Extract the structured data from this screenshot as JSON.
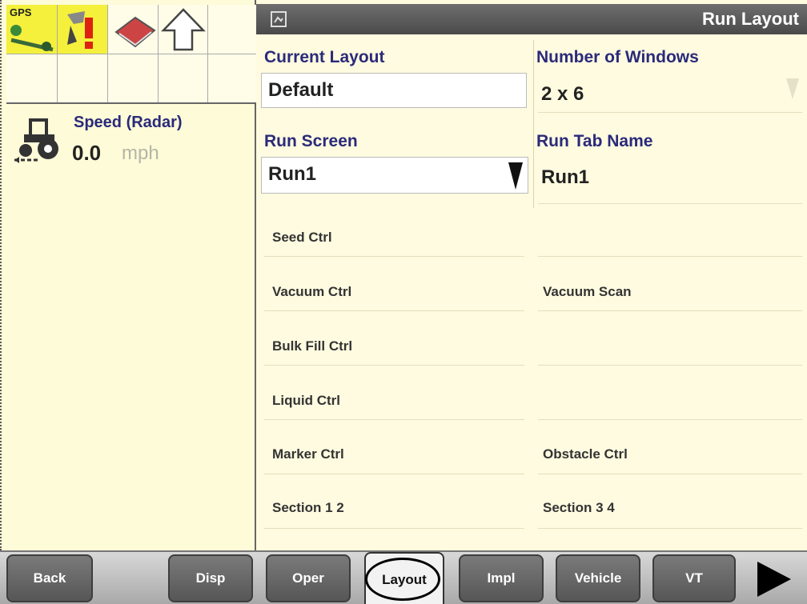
{
  "status_icons": {
    "gps_label": "GPS",
    "icons": [
      "gps-receiver-icon",
      "warning-alert-icon",
      "rate-book-icon",
      "upload-arrow-icon"
    ]
  },
  "speed": {
    "label": "Speed (Radar)",
    "value": "0.0",
    "unit": "mph",
    "icon": "tractor-icon"
  },
  "panel": {
    "title": "Run Layout",
    "current_layout_label": "Current Layout",
    "current_layout_value": "Default",
    "num_windows_label": "Number of Windows",
    "num_windows_value": "2 x 6",
    "run_screen_label": "Run Screen",
    "run_screen_value": "Run1",
    "run_tab_name_label": "Run Tab Name",
    "run_tab_name_value": "Run1"
  },
  "modules": {
    "left": [
      "Seed Ctrl",
      "Vacuum Ctrl",
      "Bulk Fill Ctrl",
      "Liquid Ctrl",
      "Marker Ctrl",
      "Section 1 2"
    ],
    "right": [
      "",
      "Vacuum Scan",
      "",
      "",
      "Obstacle Ctrl",
      "Section 3 4"
    ]
  },
  "tabs": {
    "back": "Back",
    "disp": "Disp",
    "oper": "Oper",
    "layout": "Layout",
    "impl": "Impl",
    "vehicle": "Vehicle",
    "vt": "VT"
  },
  "colors": {
    "background": "#fffbe0",
    "header_text": "#2a2a7a",
    "title_bar": "#555555",
    "gps_highlight": "#f4f03c"
  }
}
